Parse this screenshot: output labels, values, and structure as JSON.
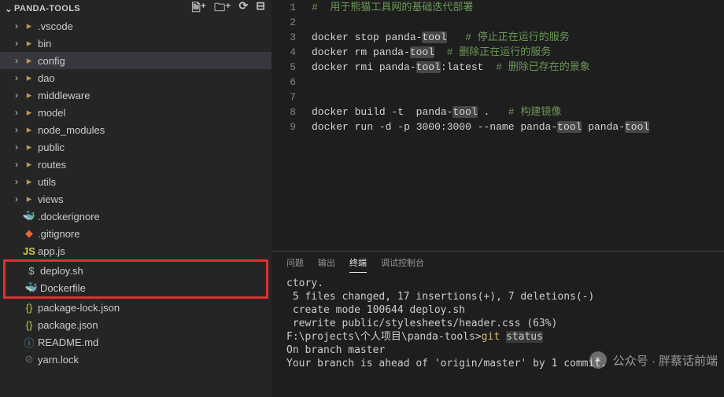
{
  "sidebar": {
    "title": "PANDA-TOOLS",
    "actions": [
      "new-file",
      "new-folder",
      "refresh",
      "collapse"
    ],
    "items": [
      {
        "name": ".vscode",
        "type": "folder",
        "icon": "folder"
      },
      {
        "name": "bin",
        "type": "folder",
        "icon": "folder"
      },
      {
        "name": "config",
        "type": "folder",
        "icon": "folder",
        "selected": true
      },
      {
        "name": "dao",
        "type": "folder",
        "icon": "folder"
      },
      {
        "name": "middleware",
        "type": "folder",
        "icon": "folder"
      },
      {
        "name": "model",
        "type": "folder",
        "icon": "folder"
      },
      {
        "name": "node_modules",
        "type": "folder",
        "icon": "folder"
      },
      {
        "name": "public",
        "type": "folder",
        "icon": "folder"
      },
      {
        "name": "routes",
        "type": "folder",
        "icon": "folder"
      },
      {
        "name": "utils",
        "type": "folder",
        "icon": "folder"
      },
      {
        "name": "views",
        "type": "folder",
        "icon": "folder"
      },
      {
        "name": ".dockerignore",
        "type": "file",
        "icon": "docker"
      },
      {
        "name": ".gitignore",
        "type": "file",
        "icon": "git"
      },
      {
        "name": "app.js",
        "type": "file",
        "icon": "js"
      }
    ],
    "highlighted": [
      {
        "name": "deploy.sh",
        "type": "file",
        "icon": "dollar"
      },
      {
        "name": "Dockerfile",
        "type": "file",
        "icon": "docker"
      }
    ],
    "after": [
      {
        "name": "package-lock.json",
        "type": "file",
        "icon": "braces"
      },
      {
        "name": "package.json",
        "type": "file",
        "icon": "braces"
      },
      {
        "name": "README.md",
        "type": "file",
        "icon": "info"
      },
      {
        "name": "yarn.lock",
        "type": "file",
        "icon": "lock"
      }
    ]
  },
  "editor": {
    "lines": [
      {
        "n": 1,
        "segs": [
          {
            "t": "#  用于熊猫工具网的基础迭代部署",
            "c": "comment"
          }
        ]
      },
      {
        "n": 2,
        "segs": []
      },
      {
        "n": 3,
        "segs": [
          {
            "t": "docker",
            "c": "cmd"
          },
          {
            "t": " "
          },
          {
            "t": "stop",
            "c": "cmd"
          },
          {
            "t": " "
          },
          {
            "t": "panda-",
            "c": "cmd"
          },
          {
            "t": "tool",
            "c": "cmd",
            "hl": true
          },
          {
            "t": " "
          },
          {
            "t": "  # 停止正在运行的服务",
            "c": "comment"
          }
        ]
      },
      {
        "n": 4,
        "segs": [
          {
            "t": "docker",
            "c": "cmd"
          },
          {
            "t": " "
          },
          {
            "t": "rm",
            "c": "cmd"
          },
          {
            "t": " "
          },
          {
            "t": "panda-",
            "c": "cmd"
          },
          {
            "t": "tool",
            "c": "cmd",
            "hl": true
          },
          {
            "t": "  "
          },
          {
            "t": "# 删除正在运行的服务",
            "c": "comment"
          }
        ]
      },
      {
        "n": 5,
        "segs": [
          {
            "t": "docker",
            "c": "cmd"
          },
          {
            "t": " "
          },
          {
            "t": "rmi",
            "c": "cmd"
          },
          {
            "t": " "
          },
          {
            "t": "panda-",
            "c": "cmd"
          },
          {
            "t": "tool",
            "c": "cmd",
            "hl": true
          },
          {
            "t": ":latest",
            "c": "cmd"
          },
          {
            "t": "  "
          },
          {
            "t": "# 删除已存在的景象",
            "c": "comment"
          }
        ]
      },
      {
        "n": 6,
        "segs": []
      },
      {
        "n": 7,
        "segs": []
      },
      {
        "n": 8,
        "segs": [
          {
            "t": "docker",
            "c": "cmd"
          },
          {
            "t": " "
          },
          {
            "t": "build",
            "c": "cmd"
          },
          {
            "t": " "
          },
          {
            "t": "-t",
            "c": "flag"
          },
          {
            "t": "  "
          },
          {
            "t": "panda-",
            "c": "cmd"
          },
          {
            "t": "tool",
            "c": "cmd",
            "hl": true
          },
          {
            "t": " "
          },
          {
            "t": ".",
            "c": "cmd"
          },
          {
            "t": "   "
          },
          {
            "t": "# 构建镜像",
            "c": "comment"
          }
        ]
      },
      {
        "n": 9,
        "segs": [
          {
            "t": "docker",
            "c": "cmd"
          },
          {
            "t": " "
          },
          {
            "t": "run",
            "c": "cmd"
          },
          {
            "t": " "
          },
          {
            "t": "-d",
            "c": "flag"
          },
          {
            "t": " "
          },
          {
            "t": "-p",
            "c": "flag"
          },
          {
            "t": " "
          },
          {
            "t": "3000:3000",
            "c": "num"
          },
          {
            "t": " "
          },
          {
            "t": "--name",
            "c": "flag"
          },
          {
            "t": " "
          },
          {
            "t": "panda-",
            "c": "cmd"
          },
          {
            "t": "tool",
            "c": "cmd",
            "hl": true
          },
          {
            "t": " "
          },
          {
            "t": "panda-",
            "c": "cmd"
          },
          {
            "t": "tool",
            "c": "cmd",
            "hl": true
          }
        ]
      }
    ]
  },
  "panel": {
    "tabs": [
      {
        "label": "问题",
        "active": false
      },
      {
        "label": "输出",
        "active": false
      },
      {
        "label": "终端",
        "active": true
      },
      {
        "label": "调试控制台",
        "active": false
      }
    ],
    "terminal": [
      "ctory.",
      " 5 files changed, 17 insertions(+), 7 deletions(-)",
      " create mode 100644 deploy.sh",
      " rewrite public/stylesheets/header.css (63%)",
      "",
      "F:\\projects\\个人项目\\panda-tools>git status",
      "On branch master",
      "Your branch is ahead of 'origin/master' by 1 commit."
    ],
    "git_prompt_hl": "status"
  },
  "watermark": {
    "label": "公众号 · 胖蔡话前端"
  },
  "icons": {
    "folder": "▸",
    "docker": "🐳",
    "git": "◆",
    "js": "JS",
    "dollar": "$",
    "braces": "{}",
    "info": "ⓘ",
    "lock": "⊘",
    "ignore": "⊘"
  }
}
